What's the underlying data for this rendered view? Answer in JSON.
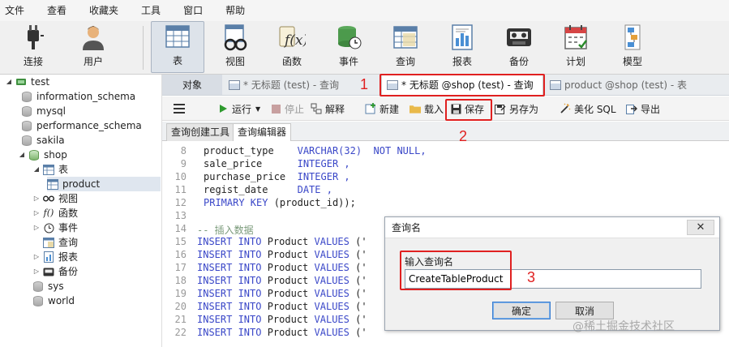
{
  "menu": [
    "文件",
    "查看",
    "收藏夹",
    "工具",
    "窗口",
    "帮助"
  ],
  "toolbar": {
    "connect": "连接",
    "user": "用户",
    "table": "表",
    "view": "视图",
    "function": "函数",
    "event": "事件",
    "query": "查询",
    "report": "报表",
    "backup": "备份",
    "schedule": "计划",
    "model": "模型"
  },
  "tree": {
    "connection": "test",
    "databases": [
      "information_schema",
      "mysql",
      "performance_schema",
      "sakila"
    ],
    "shop": {
      "name": "shop",
      "tables_folder": "表",
      "table_item": "product",
      "views": "视图",
      "functions": "函数",
      "events": "事件",
      "queries": "查询",
      "reports": "报表",
      "backups": "备份"
    },
    "databases_after": [
      "sys",
      "world"
    ]
  },
  "tabs": {
    "objects": "对象",
    "tab1": "* 无标题 (test) - 查询",
    "tab2": "* 无标题 @shop (test) - 查询",
    "tab3": "product @shop (test) - 表"
  },
  "query_toolbar": {
    "run": "运行",
    "stop": "停止",
    "explain": "解释",
    "new": "新建",
    "load": "载入",
    "save": "保存",
    "save_as": "另存为",
    "beautify": "美化 SQL",
    "export": "导出"
  },
  "subtabs": {
    "builder": "查询创建工具",
    "editor": "查询编辑器"
  },
  "editor": {
    "line_numbers": [
      "8",
      "9",
      "10",
      "11",
      "12",
      "13",
      "14",
      "15",
      "16",
      "17",
      "18",
      "19",
      "20",
      "21",
      "22"
    ],
    "col_product_type": "product_type",
    "type_varchar": "VARCHAR(32)",
    "not_null": "NOT NULL,",
    "col_sale_price": "sale_price",
    "col_purchase_price": "purchase_price",
    "type_integer": "INTEGER ,",
    "col_regist_date": "regist_date",
    "type_date": "DATE ,",
    "primary_key": "PRIMARY KEY",
    "pk_rest": " (product_id));",
    "comment": "-- 插入数据",
    "insert_kw": "INSERT INTO",
    "table_name": " Product ",
    "values_kw": "VALUES",
    "values_paren": " ('"
  },
  "annotations": [
    "1",
    "2",
    "3"
  ],
  "dialog": {
    "title": "查询名",
    "label": "输入查询名",
    "input_value": "CreateTableProduct",
    "ok": "确定",
    "cancel": "取消"
  },
  "watermark": "@稀土掘金技术社区",
  "colors": {
    "highlight": "#e02020",
    "keyword": "#3a47c8",
    "comment": "#7a9a7a"
  }
}
